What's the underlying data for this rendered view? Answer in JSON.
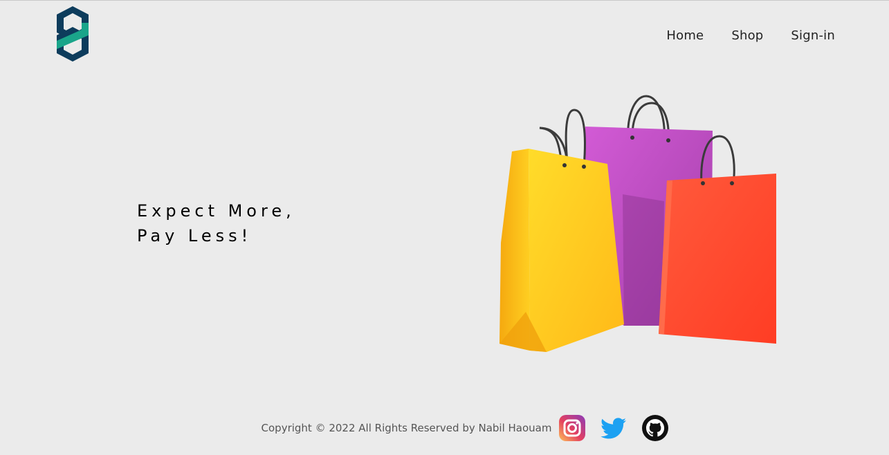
{
  "header": {
    "logo_icon": "brand-logo-icon",
    "nav": [
      {
        "label": "Home"
      },
      {
        "label": "Shop"
      },
      {
        "label": "Sign-in"
      }
    ]
  },
  "hero": {
    "line1": "Expect More,",
    "line2": "Pay Less!",
    "image_icon": "shopping-bags-illustration"
  },
  "footer": {
    "copyright": "Copyright © 2022 All Rights Reserved by Nabil Haouam",
    "social": [
      {
        "name": "instagram-icon"
      },
      {
        "name": "twitter-icon"
      },
      {
        "name": "github-icon"
      }
    ]
  },
  "colors": {
    "background": "#ebebeb",
    "logo_dark": "#0d3c5c",
    "logo_accent": "#1aa58a",
    "bag_yellow": "#ffc41f",
    "bag_purple": "#c352c7",
    "bag_red": "#ff4b32",
    "twitter": "#1da1f2"
  }
}
